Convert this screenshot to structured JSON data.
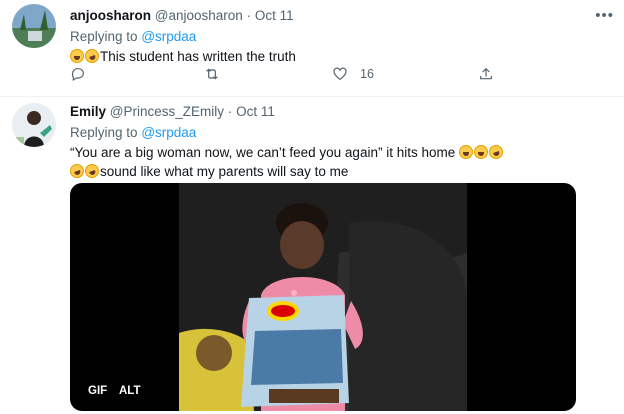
{
  "tweets": [
    {
      "display_name": "anjoosharon",
      "handle": "@anjoosharon",
      "separator": "·",
      "date": "Oct 11",
      "replying_prefix": "Replying to",
      "replying_handle": "@srpdaa",
      "text": "This student has written the truth",
      "like_count": "16",
      "more_icon": "more-horizontal-icon"
    },
    {
      "display_name": "Emily",
      "handle": "@Princess_ZEmily",
      "separator": "·",
      "date": "Oct 11",
      "replying_prefix": "Replying to",
      "replying_handle": "@srpdaa",
      "text_line1": "“You are a big woman now, we can’t feed you again”  it hits home",
      "text_line2": "sound like what my parents will say to me",
      "media_badges": {
        "gif": "GIF",
        "alt": "ALT"
      }
    }
  ],
  "colors": {
    "accent": "#1d9bf0",
    "muted": "#536471",
    "text": "#0f1419"
  }
}
